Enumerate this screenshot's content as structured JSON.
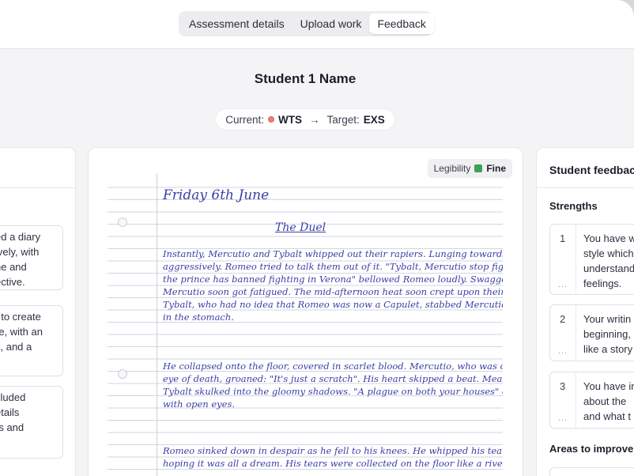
{
  "tabs": [
    {
      "label": "Assessment details",
      "active": false
    },
    {
      "label": "Upload work",
      "active": false
    },
    {
      "label": "Feedback",
      "active": true
    }
  ],
  "student": {
    "name": "Student 1 Name",
    "current_label": "Current:",
    "current_level": "WTS",
    "arrow": "→",
    "target_label": "Target:",
    "target_level": "EXS",
    "current_color": "#ef7b7b"
  },
  "left_panel": {
    "cards": [
      {
        "lines": [
          "ed a diary",
          "ively, with",
          "ne and",
          "ective."
        ]
      },
      {
        "lines": [
          "t to create",
          "re, with an",
          "s, and a"
        ]
      },
      {
        "lines": [
          "cluded",
          "etails",
          "rs and"
        ]
      }
    ]
  },
  "legibility": {
    "label": "Legibility",
    "value": "Fine",
    "color": "#3aa356"
  },
  "handwriting": {
    "date": "Friday 6th June",
    "title": "The Duel",
    "lines": [
      "Instantly, Mercutio and Tybalt whipped out their rapiers. Lunging towards each others",
      "aggressively. Romeo tried to talk them out of it. \"Tybalt, Mercutio stop fighting immediately",
      "the prince has banned fighting in Verona\" bellowed Romeo loudly. Swaggering towards Tybalt,",
      "Mercutio soon got fatigued. The mid-afternoon heat soon crept upon their tired and strained.",
      "Tybalt, who had no idea that Romeo was now a Capulet, stabbed Mercutio hideously",
      "in the stomach.",
      "He collapsed onto the floor, covered in scarlet blood. Mercutio, who was on the",
      "eye of death, groaned: \"It's just a scratch\". His heart skipped a beat. Meanwhile,",
      "Tybalt skulked into the gloomy shadows. \"A plague on both your houses\" cried Mercutio",
      "with open eyes.",
      "Romeo sinked down in despair as he fell to his knees. He whipped his tears in sorrow",
      "hoping it was all a dream. His tears were collected on the floor like a river full of sadness."
    ]
  },
  "right_panel": {
    "title": "Student feedback",
    "strengths_title": "Strengths",
    "strengths": [
      {
        "num": "1",
        "lines": [
          "You have w",
          "style which",
          "understand",
          "feelings."
        ]
      },
      {
        "num": "2",
        "lines": [
          "Your writin",
          "beginning,",
          "like a story"
        ]
      },
      {
        "num": "3",
        "lines": [
          "You have in",
          "about the",
          "and what t"
        ]
      }
    ],
    "improve_title": "Areas to improve",
    "dots": "..."
  }
}
